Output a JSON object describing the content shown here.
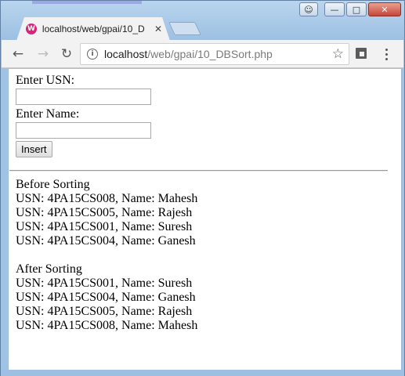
{
  "browser": {
    "tab_title": "localhost/web/gpai/10_D",
    "favicon_letter": "W",
    "url_host": "localhost",
    "url_path": "/web/gpai/10_DBSort.php",
    "icons": {
      "back": "back-arrow-icon",
      "forward": "forward-arrow-icon",
      "reload": "reload-icon",
      "info": "info-icon",
      "star": "star-icon",
      "extension": "extension-icon",
      "menu": "menu-icon"
    }
  },
  "form": {
    "usn_label": "Enter USN:",
    "usn_value": "",
    "name_label": "Enter Name:",
    "name_value": "",
    "insert_label": "Insert"
  },
  "before": {
    "heading": "Before Sorting",
    "rows": [
      "USN: 4PA15CS008, Name: Mahesh",
      "USN: 4PA15CS005, Name: Rajesh",
      "USN: 4PA15CS001, Name: Suresh",
      "USN: 4PA15CS004, Name: Ganesh"
    ]
  },
  "after": {
    "heading": "After Sorting",
    "rows": [
      "USN: 4PA15CS001, Name: Suresh",
      "USN: 4PA15CS004, Name: Ganesh",
      "USN: 4PA15CS005, Name: Rajesh",
      "USN: 4PA15CS008, Name: Mahesh"
    ]
  },
  "colors": {
    "window_frame": "#9dc0e2",
    "favicon": "#d6257a",
    "close_button": "#c7463a"
  }
}
